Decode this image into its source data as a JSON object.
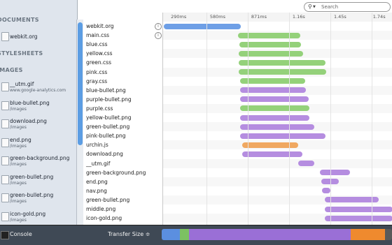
{
  "sidebar": {
    "sections": {
      "documents": "DOCUMENTS",
      "stylesheets": "STYLESHEETS",
      "images": "IMAGES"
    },
    "documents": [
      {
        "name": "webkit.org"
      }
    ],
    "images": [
      {
        "name": "__utm.gif",
        "sub": "www.google-analytics.com"
      },
      {
        "name": "blue-bullet.png",
        "sub": "/images"
      },
      {
        "name": "download.png",
        "sub": "/images"
      },
      {
        "name": "end.png",
        "sub": "/images"
      },
      {
        "name": "green-background.png",
        "sub": "/images"
      },
      {
        "name": "green-bullet.png",
        "sub": "/images"
      },
      {
        "name": "green-bullet.png",
        "sub": "/images"
      },
      {
        "name": "icon-gold.png",
        "sub": "/images"
      }
    ]
  },
  "search": {
    "placeholder": "Search"
  },
  "ruler": {
    "ticks": [
      "290ms",
      "580ms",
      "871ms",
      "1.16s",
      "1.45s",
      "1.74s"
    ]
  },
  "resources": [
    {
      "name": "webkit.org",
      "info": "i",
      "type": "document",
      "start": 0.2,
      "end": 33.8
    },
    {
      "name": "main.css",
      "info": "i",
      "type": "stylesheet",
      "start": 32.5,
      "end": 59.8
    },
    {
      "name": "blue.css",
      "type": "stylesheet",
      "start": 33.2,
      "end": 60.2
    },
    {
      "name": "yellow.css",
      "type": "stylesheet",
      "start": 33.0,
      "end": 60.9
    },
    {
      "name": "green.css",
      "type": "stylesheet",
      "start": 32.9,
      "end": 70.8
    },
    {
      "name": "pink.css",
      "type": "stylesheet",
      "start": 32.9,
      "end": 70.9
    },
    {
      "name": "gray.css",
      "type": "stylesheet",
      "start": 33.5,
      "end": 62.0
    },
    {
      "name": "blue-bullet.png",
      "type": "image",
      "start": 33.6,
      "end": 62.2
    },
    {
      "name": "purple-bullet.png",
      "type": "image",
      "start": 33.5,
      "end": 63.4
    },
    {
      "name": "purple.css",
      "type": "stylesheet",
      "start": 33.6,
      "end": 63.7
    },
    {
      "name": "yellow-bullet.png",
      "type": "image",
      "start": 33.6,
      "end": 63.6
    },
    {
      "name": "green-bullet.png",
      "type": "image",
      "start": 33.6,
      "end": 65.8
    },
    {
      "name": "pink-bullet.png",
      "type": "image",
      "start": 33.6,
      "end": 70.6
    },
    {
      "name": "urchin.js",
      "type": "script",
      "start": 34.3,
      "end": 58.9
    },
    {
      "name": "download.png",
      "type": "image",
      "start": 34.3,
      "end": 60.8
    },
    {
      "name": "__utm.gif",
      "type": "image",
      "start": 58.9,
      "end": 66.0
    },
    {
      "name": "green-background.png",
      "type": "image",
      "start": 68.3,
      "end": 81.4
    },
    {
      "name": "end.png",
      "type": "image",
      "start": 69.0,
      "end": 76.6
    },
    {
      "name": "nav.png",
      "type": "image",
      "start": 69.3,
      "end": 73.0
    },
    {
      "name": "green-bullet.png",
      "type": "image",
      "start": 70.3,
      "end": 93.8
    },
    {
      "name": "middle.png",
      "type": "image",
      "start": 70.3,
      "end": 100
    },
    {
      "name": "icon-gold.png",
      "type": "image",
      "start": 70.5,
      "end": 100
    }
  ],
  "colors": {
    "document": "#6e9fe6",
    "stylesheet": "#94d17a",
    "image": "#b58de0",
    "script": "#f0a861"
  },
  "bottom": {
    "console_label": "Console",
    "metric_label": "Transfer Size ≑",
    "strip": [
      {
        "type": "document",
        "pct": 8
      },
      {
        "type": "stylesheet",
        "pct": 4
      },
      {
        "type": "image",
        "pct": 70
      },
      {
        "type": "script",
        "pct": 15
      },
      {
        "type": "other",
        "pct": 3
      }
    ],
    "strip_colors": {
      "document": "#5b8fe0",
      "stylesheet": "#7cc162",
      "image": "#9a6fd6",
      "script": "#ef8a2e",
      "other": "#5a5a5a"
    }
  }
}
